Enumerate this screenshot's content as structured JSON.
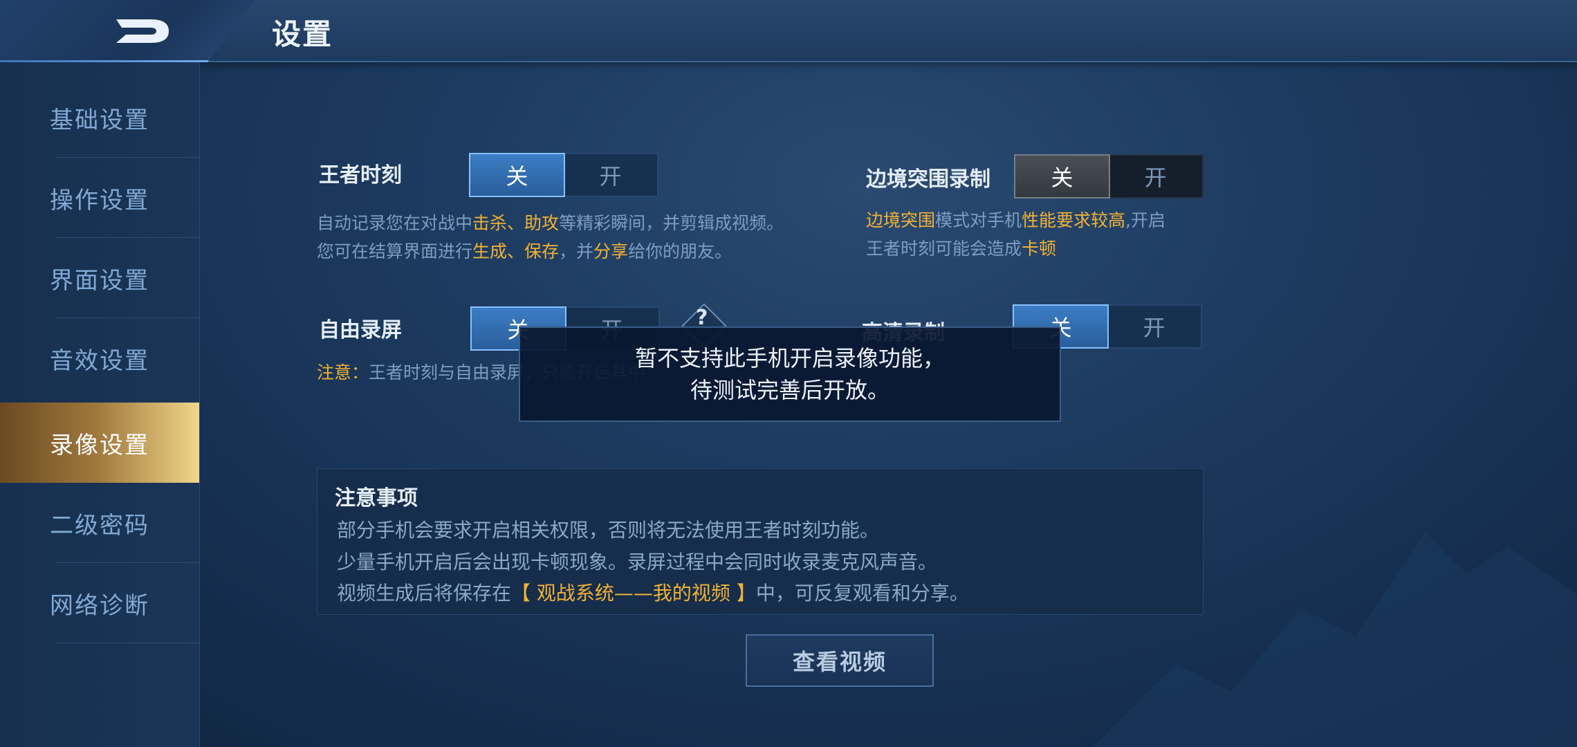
{
  "header": {
    "title": "设置"
  },
  "sidebar": {
    "items": [
      {
        "label": "基础设置"
      },
      {
        "label": "操作设置"
      },
      {
        "label": "界面设置"
      },
      {
        "label": "音效设置"
      },
      {
        "label": "录像设置",
        "active": true
      },
      {
        "label": "二级密码"
      },
      {
        "label": "网络诊断"
      }
    ]
  },
  "settings": {
    "king_moment": {
      "label": "王者时刻",
      "off": "关",
      "on": "开",
      "selected": "关",
      "desc1_a": "自动记录您在对战中",
      "desc1_b": "击杀",
      "desc1_c": "、",
      "desc1_d": "助攻",
      "desc1_e": "等精彩瞬间，并剪辑成视频。",
      "desc2_a": "您可在结算界面进行",
      "desc2_b": "生成",
      "desc2_c": "、",
      "desc2_d": "保存",
      "desc2_e": "，并",
      "desc2_f": "分享",
      "desc2_g": "给你的朋友。"
    },
    "border_breakout": {
      "label": "边境突围录制",
      "off": "关",
      "on": "开",
      "selected": "关",
      "desc1_a": "边境突围",
      "desc1_b": "模式对手机",
      "desc1_c": "性能要求较高",
      "desc1_d": ",开启",
      "desc2_a": "王者时刻可能会造成",
      "desc2_b": "卡顿"
    },
    "free_record": {
      "label": "自由录屏",
      "off": "关",
      "on": "开",
      "selected": "关",
      "help": "?",
      "note_a": "注意：",
      "note_b": "王者时刻与自由录屏，只能开启其中"
    },
    "hd_record": {
      "label": "高清录制",
      "off": "关",
      "on": "开",
      "selected": "关"
    }
  },
  "notice": {
    "title": "注意事项",
    "line1": "部分手机会要求开启相关权限，否则将无法使用王者时刻功能。",
    "line2": "少量手机开启后会出现卡顿现象。录屏过程中会同时收录麦克风声音。",
    "line3_a": "视频生成后将保存在",
    "line3_b": "【 观战系统——我的视频 】",
    "line3_c": "中，可反复观看和分享。"
  },
  "view_button": {
    "label": "查看视频"
  },
  "toast": {
    "line1": "暂不支持此手机开启录像功能，",
    "line2": "待测试完善后开放。"
  }
}
